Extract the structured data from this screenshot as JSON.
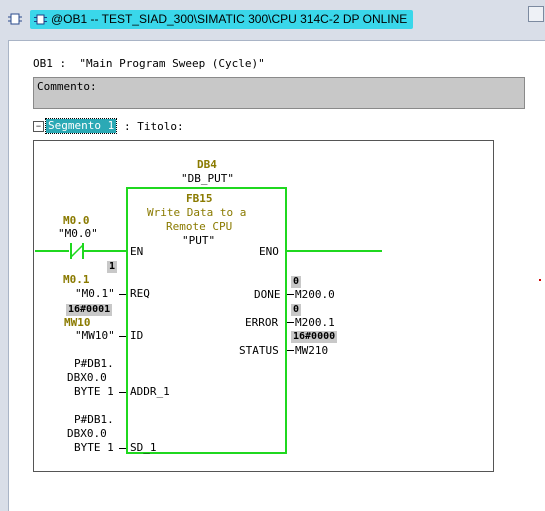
{
  "window": {
    "title": "@OB1 -- TEST_SIAD_300\\SIMATIC 300\\CPU 314C-2 DP  ONLINE",
    "accent_color": "#3ad7ea"
  },
  "block": {
    "header": "OB1 :  \"Main Program Sweep (Cycle)\"",
    "comment_label": "Commento:"
  },
  "segment": {
    "toggle": "−",
    "name": "Segmento 1",
    "title": ": Titolo:"
  },
  "fb": {
    "db_name": "DB4",
    "db_symbol": "\"DB_PUT\"",
    "fb_name": "FB15",
    "desc_line1": "Write Data to a",
    "desc_line2": "Remote CPU",
    "symbol": "\"PUT\"",
    "line_color": "#1fd81f"
  },
  "inputs": {
    "en": {
      "address": "M0.0",
      "symbol": "\"M0.0\"",
      "pin": "EN"
    },
    "en_status": "1",
    "req": {
      "address": "M0.1",
      "symbol": "\"M0.1\"",
      "pin": "REQ"
    },
    "req_status": "16#0001",
    "id": {
      "address": "MW10",
      "symbol": "\"MW10\"",
      "pin": "ID"
    },
    "addr1": {
      "line1": "P#DB1.",
      "line2": "DBX0.0",
      "line3": "BYTE 1",
      "pin": "ADDR_1"
    },
    "sd1": {
      "line1": "P#DB1.",
      "line2": "DBX0.0",
      "line3": "BYTE 1",
      "pin": "SD_1"
    }
  },
  "outputs": {
    "eno": {
      "pin": "ENO"
    },
    "done": {
      "pin": "DONE",
      "status": "0",
      "address": "M200.0"
    },
    "error": {
      "pin": "ERROR",
      "status": "0",
      "address": "M200.1"
    },
    "status": {
      "pin": "STATUS",
      "status": "16#0000",
      "address": "MW210"
    }
  }
}
